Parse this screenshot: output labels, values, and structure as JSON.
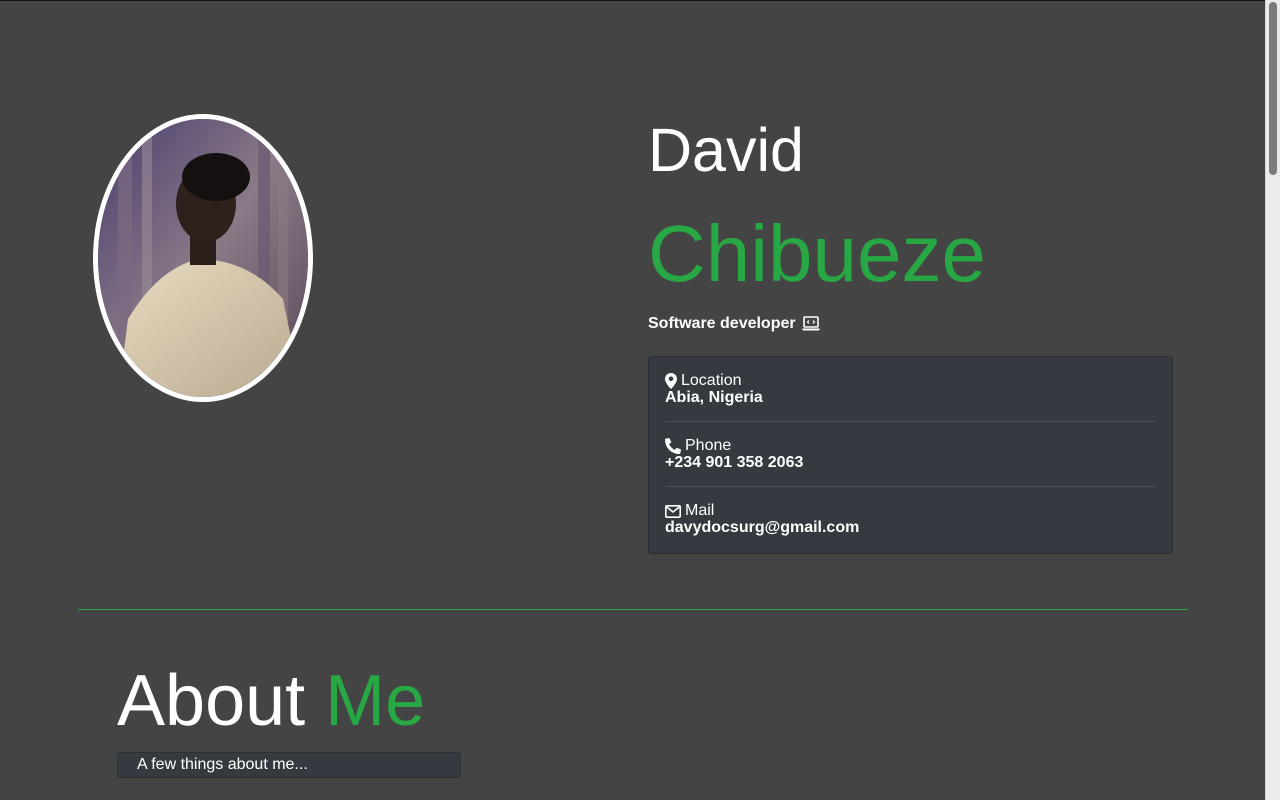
{
  "profile": {
    "first_name": "David",
    "last_name": "Chibueze",
    "role": "Software developer",
    "role_icon": "laptop-code-icon"
  },
  "contact": {
    "location_label": "Location",
    "location_value": "Abia, Nigeria",
    "phone_label": "Phone",
    "phone_value": "+234 901 358 2063",
    "mail_label": "Mail",
    "mail_value": "davydocsurg@gmail.com"
  },
  "about": {
    "title_part1": "About",
    "title_part2": "Me",
    "subtitle": "A few things about me..."
  },
  "colors": {
    "background": "#444444",
    "accent": "#28a745",
    "card": "#343a40"
  }
}
